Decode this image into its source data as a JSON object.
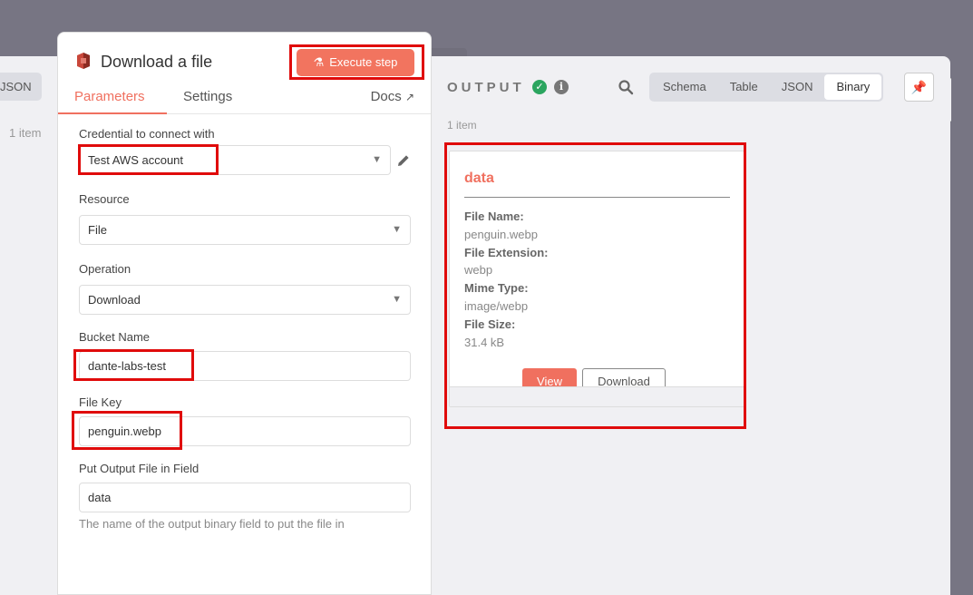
{
  "left_panel": {
    "json_tab_label": "JSON",
    "items_count": "1 item"
  },
  "node": {
    "title": "Download a file",
    "execute_label": "Execute step",
    "tabs": [
      {
        "label": "Parameters",
        "active": true
      },
      {
        "label": "Settings",
        "active": false
      }
    ],
    "docs_label": "Docs"
  },
  "fields": {
    "credential": {
      "label": "Credential to connect with",
      "value": "Test AWS account"
    },
    "resource": {
      "label": "Resource",
      "value": "File"
    },
    "operation": {
      "label": "Operation",
      "value": "Download"
    },
    "bucket": {
      "label": "Bucket Name",
      "value": "dante-labs-test"
    },
    "file_key": {
      "label": "File Key",
      "value": "penguin.webp"
    },
    "output_field": {
      "label": "Put Output File in Field",
      "value": "data",
      "hint": "The name of the output binary field to put the file in"
    }
  },
  "output": {
    "title": "OUTPUT",
    "view_tabs": [
      "Schema",
      "Table",
      "JSON",
      "Binary"
    ],
    "active_view": "Binary",
    "items_count": "1 item",
    "binary": {
      "key": "data",
      "file_name_label": "File Name:",
      "file_name": "penguin.webp",
      "file_extension_label": "File Extension:",
      "file_extension": "webp",
      "mime_type_label": "Mime Type:",
      "mime_type": "image/webp",
      "file_size_label": "File Size:",
      "file_size": "31.4 kB",
      "view_label": "View",
      "download_label": "Download"
    }
  },
  "colors": {
    "accent": "#f0705f",
    "highlight": "#e00b0b",
    "success": "#2ba55f"
  }
}
